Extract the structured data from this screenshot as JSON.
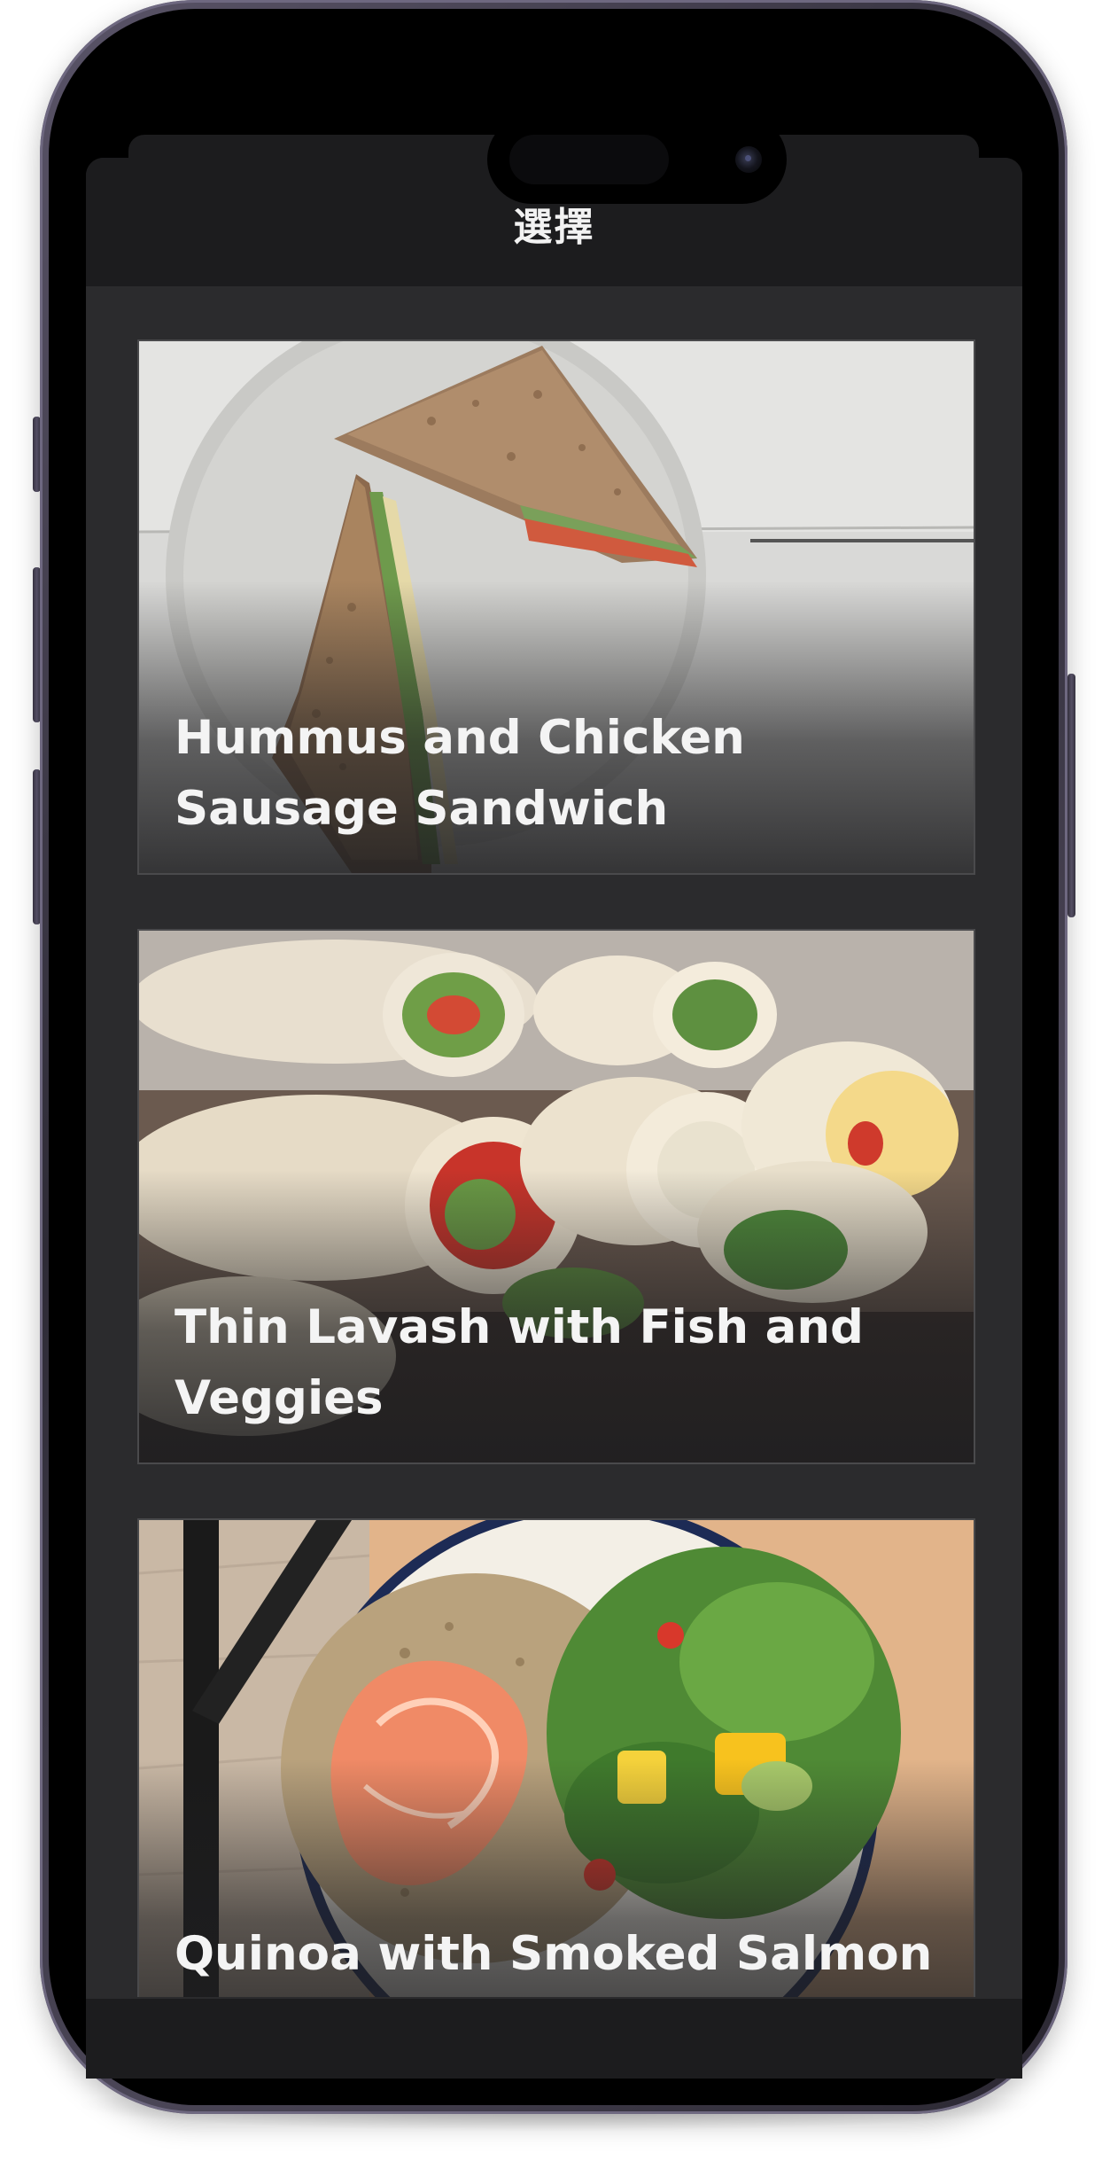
{
  "nav": {
    "title": "選擇"
  },
  "recipes": [
    {
      "title": "Hummus and Chicken Sausage Sandwich",
      "icon": "sandwich-photo"
    },
    {
      "title": "Thin Lavash with Fish and Veggies",
      "icon": "lavash-wrap-photo"
    },
    {
      "title": "Quinoa with Smoked Salmon and Salad",
      "icon": "salmon-quinoa-photo"
    }
  ],
  "colors": {
    "sheet_background": "#2b2b2d",
    "nav_background": "#1c1c1e",
    "title_text": "#f4f4f4"
  }
}
